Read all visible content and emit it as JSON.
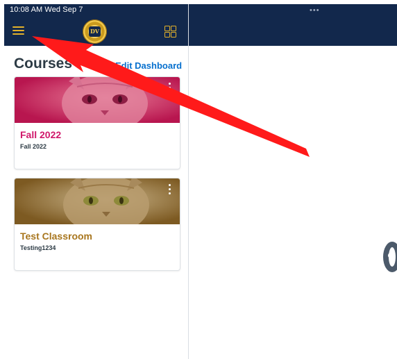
{
  "status_bar": {
    "time": "10:08 AM  Wed Sep 7"
  },
  "multitask_dots": "•••",
  "header": {
    "menu_icon": "hamburger-icon",
    "logo_letters": "DV",
    "grid_icon": "grid-icon"
  },
  "dashboard": {
    "title": "Courses",
    "edit_label": "Edit Dashboard"
  },
  "courses": [
    {
      "name": "Fall 2022",
      "code": "Fall 2022",
      "color": "#d0176a"
    },
    {
      "name": "Test Classroom",
      "code": "Testing1234",
      "color": "#a8761e"
    }
  ],
  "colors": {
    "header": "#12284c",
    "accent": "#e4b22a",
    "link": "#0770ce",
    "annotation_arrow": "#ff1a1a"
  }
}
